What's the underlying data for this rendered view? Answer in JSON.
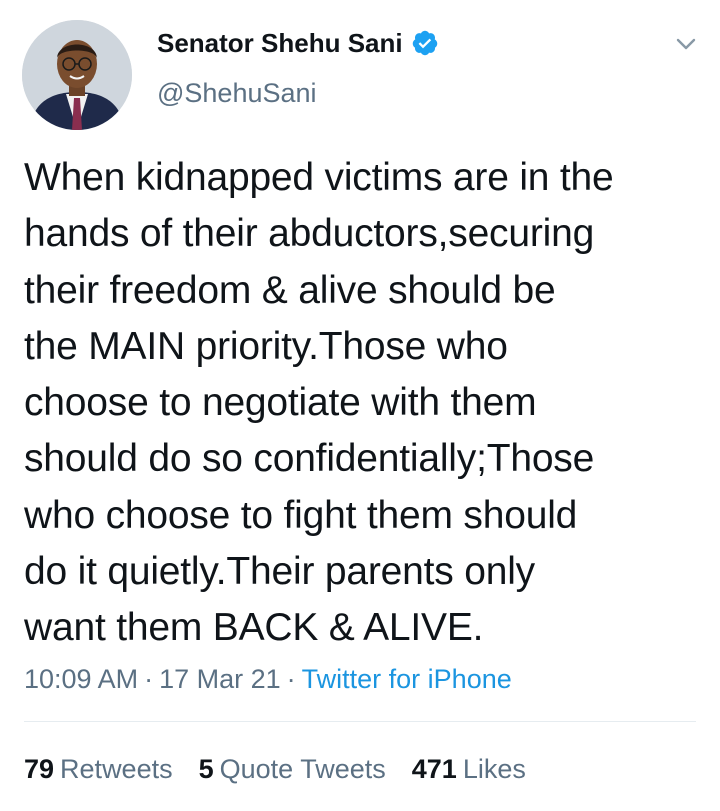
{
  "author": {
    "display_name": "Senator Shehu Sani",
    "handle": "@ShehuSani",
    "verified": true,
    "avatar_icon": "profile-photo"
  },
  "tweet": {
    "text": "When kidnapped victims are in the\nhands of their abductors,securing\ntheir freedom & alive should be\nthe MAIN priority.Those who\nchoose to negotiate with them\nshould do so confidentially;Those\nwho choose to fight them should\ndo it quietly.Their parents only\nwant them BACK & ALIVE.",
    "time": "10:09 AM",
    "separator": "·",
    "date": "17 Mar 21",
    "source": "Twitter for iPhone"
  },
  "stats": {
    "retweets_count": "79",
    "retweets_label": "Retweets",
    "quote_count": "5",
    "quote_label": "Quote Tweets",
    "likes_count": "471",
    "likes_label": "Likes"
  },
  "colors": {
    "text": "#0f1419",
    "secondary": "#5b7083",
    "link": "#1b95e0",
    "verified": "#1da1f2",
    "divider": "#e6ecf0"
  },
  "icons": {
    "verified": "verified-badge-icon",
    "menu": "chevron-down-icon"
  }
}
